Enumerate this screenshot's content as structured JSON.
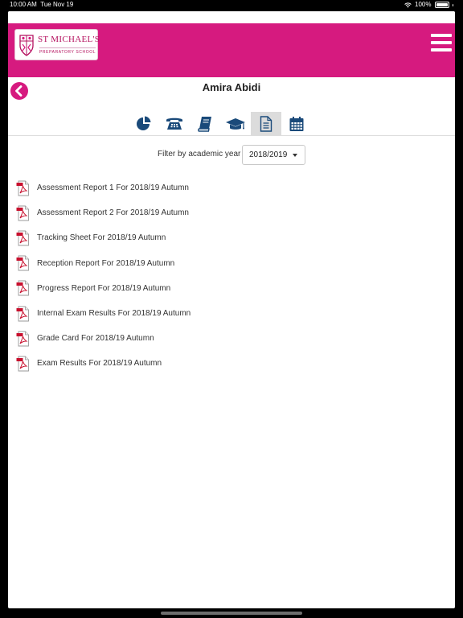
{
  "status_bar": {
    "time": "10:00 AM",
    "date": "Tue Nov 19",
    "battery": "100%"
  },
  "header": {
    "logo_name": "ST MICHAEL'S",
    "logo_subtitle": "PREPARATORY SCHOOL",
    "brand_color": "#d61a7f"
  },
  "student": {
    "name": "Amira Abidi"
  },
  "tabs": [
    {
      "icon": "pie-chart-icon",
      "active": false
    },
    {
      "icon": "phone-icon",
      "active": false
    },
    {
      "icon": "book-icon",
      "active": false
    },
    {
      "icon": "graduation-cap-icon",
      "active": false
    },
    {
      "icon": "document-icon",
      "active": true
    },
    {
      "icon": "calendar-icon",
      "active": false
    }
  ],
  "filter": {
    "label": "Filter by academic year",
    "selected_year": "2018/2019"
  },
  "reports": [
    {
      "label": "Assessment Report 1 For 2018/19 Autumn"
    },
    {
      "label": "Assessment Report 2 For 2018/19 Autumn"
    },
    {
      "label": "Tracking Sheet For 2018/19 Autumn"
    },
    {
      "label": "Reception Report For 2018/19 Autumn"
    },
    {
      "label": "Progress Report For 2018/19 Autumn"
    },
    {
      "label": "Internal Exam Results For 2018/19 Autumn"
    },
    {
      "label": "Grade Card For 2018/19 Autumn"
    },
    {
      "label": "Exam Results For 2018/19 Autumn"
    }
  ]
}
